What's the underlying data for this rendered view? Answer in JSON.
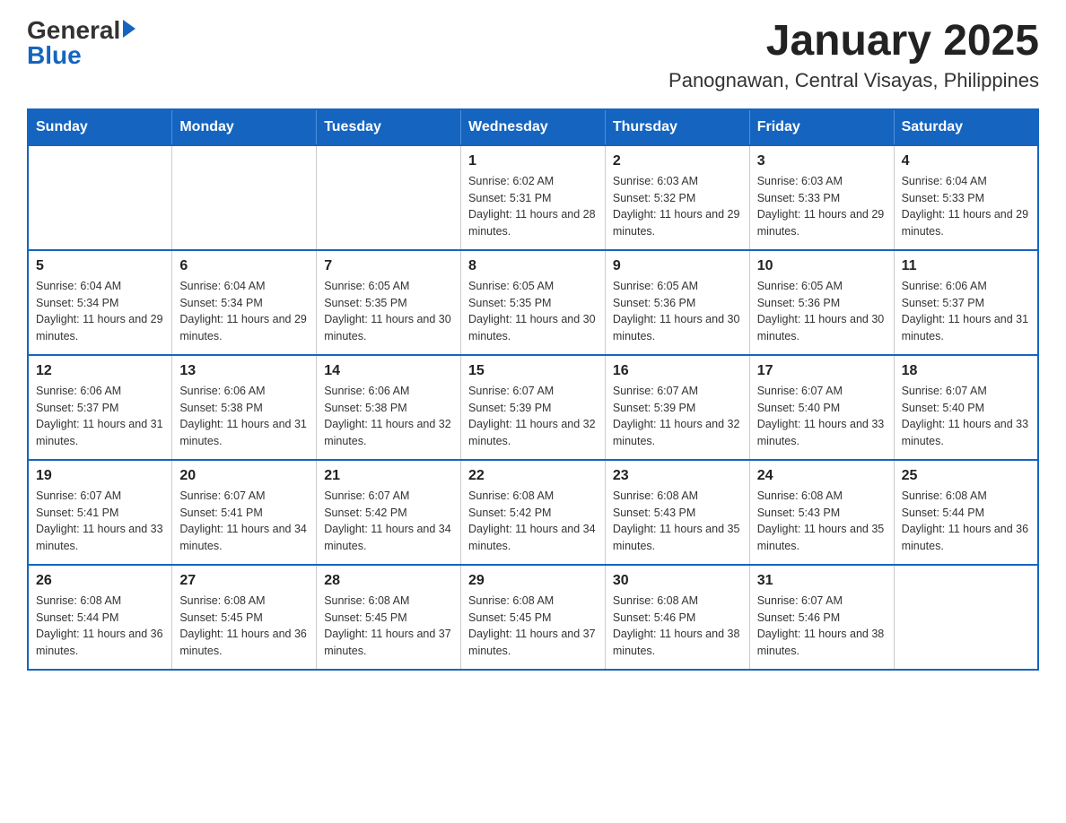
{
  "logo": {
    "general": "General",
    "blue": "Blue"
  },
  "title": "January 2025",
  "subtitle": "Panognawan, Central Visayas, Philippines",
  "days_header": [
    "Sunday",
    "Monday",
    "Tuesday",
    "Wednesday",
    "Thursday",
    "Friday",
    "Saturday"
  ],
  "weeks": [
    [
      {
        "day": "",
        "info": ""
      },
      {
        "day": "",
        "info": ""
      },
      {
        "day": "",
        "info": ""
      },
      {
        "day": "1",
        "info": "Sunrise: 6:02 AM\nSunset: 5:31 PM\nDaylight: 11 hours and 28 minutes."
      },
      {
        "day": "2",
        "info": "Sunrise: 6:03 AM\nSunset: 5:32 PM\nDaylight: 11 hours and 29 minutes."
      },
      {
        "day": "3",
        "info": "Sunrise: 6:03 AM\nSunset: 5:33 PM\nDaylight: 11 hours and 29 minutes."
      },
      {
        "day": "4",
        "info": "Sunrise: 6:04 AM\nSunset: 5:33 PM\nDaylight: 11 hours and 29 minutes."
      }
    ],
    [
      {
        "day": "5",
        "info": "Sunrise: 6:04 AM\nSunset: 5:34 PM\nDaylight: 11 hours and 29 minutes."
      },
      {
        "day": "6",
        "info": "Sunrise: 6:04 AM\nSunset: 5:34 PM\nDaylight: 11 hours and 29 minutes."
      },
      {
        "day": "7",
        "info": "Sunrise: 6:05 AM\nSunset: 5:35 PM\nDaylight: 11 hours and 30 minutes."
      },
      {
        "day": "8",
        "info": "Sunrise: 6:05 AM\nSunset: 5:35 PM\nDaylight: 11 hours and 30 minutes."
      },
      {
        "day": "9",
        "info": "Sunrise: 6:05 AM\nSunset: 5:36 PM\nDaylight: 11 hours and 30 minutes."
      },
      {
        "day": "10",
        "info": "Sunrise: 6:05 AM\nSunset: 5:36 PM\nDaylight: 11 hours and 30 minutes."
      },
      {
        "day": "11",
        "info": "Sunrise: 6:06 AM\nSunset: 5:37 PM\nDaylight: 11 hours and 31 minutes."
      }
    ],
    [
      {
        "day": "12",
        "info": "Sunrise: 6:06 AM\nSunset: 5:37 PM\nDaylight: 11 hours and 31 minutes."
      },
      {
        "day": "13",
        "info": "Sunrise: 6:06 AM\nSunset: 5:38 PM\nDaylight: 11 hours and 31 minutes."
      },
      {
        "day": "14",
        "info": "Sunrise: 6:06 AM\nSunset: 5:38 PM\nDaylight: 11 hours and 32 minutes."
      },
      {
        "day": "15",
        "info": "Sunrise: 6:07 AM\nSunset: 5:39 PM\nDaylight: 11 hours and 32 minutes."
      },
      {
        "day": "16",
        "info": "Sunrise: 6:07 AM\nSunset: 5:39 PM\nDaylight: 11 hours and 32 minutes."
      },
      {
        "day": "17",
        "info": "Sunrise: 6:07 AM\nSunset: 5:40 PM\nDaylight: 11 hours and 33 minutes."
      },
      {
        "day": "18",
        "info": "Sunrise: 6:07 AM\nSunset: 5:40 PM\nDaylight: 11 hours and 33 minutes."
      }
    ],
    [
      {
        "day": "19",
        "info": "Sunrise: 6:07 AM\nSunset: 5:41 PM\nDaylight: 11 hours and 33 minutes."
      },
      {
        "day": "20",
        "info": "Sunrise: 6:07 AM\nSunset: 5:41 PM\nDaylight: 11 hours and 34 minutes."
      },
      {
        "day": "21",
        "info": "Sunrise: 6:07 AM\nSunset: 5:42 PM\nDaylight: 11 hours and 34 minutes."
      },
      {
        "day": "22",
        "info": "Sunrise: 6:08 AM\nSunset: 5:42 PM\nDaylight: 11 hours and 34 minutes."
      },
      {
        "day": "23",
        "info": "Sunrise: 6:08 AM\nSunset: 5:43 PM\nDaylight: 11 hours and 35 minutes."
      },
      {
        "day": "24",
        "info": "Sunrise: 6:08 AM\nSunset: 5:43 PM\nDaylight: 11 hours and 35 minutes."
      },
      {
        "day": "25",
        "info": "Sunrise: 6:08 AM\nSunset: 5:44 PM\nDaylight: 11 hours and 36 minutes."
      }
    ],
    [
      {
        "day": "26",
        "info": "Sunrise: 6:08 AM\nSunset: 5:44 PM\nDaylight: 11 hours and 36 minutes."
      },
      {
        "day": "27",
        "info": "Sunrise: 6:08 AM\nSunset: 5:45 PM\nDaylight: 11 hours and 36 minutes."
      },
      {
        "day": "28",
        "info": "Sunrise: 6:08 AM\nSunset: 5:45 PM\nDaylight: 11 hours and 37 minutes."
      },
      {
        "day": "29",
        "info": "Sunrise: 6:08 AM\nSunset: 5:45 PM\nDaylight: 11 hours and 37 minutes."
      },
      {
        "day": "30",
        "info": "Sunrise: 6:08 AM\nSunset: 5:46 PM\nDaylight: 11 hours and 38 minutes."
      },
      {
        "day": "31",
        "info": "Sunrise: 6:07 AM\nSunset: 5:46 PM\nDaylight: 11 hours and 38 minutes."
      },
      {
        "day": "",
        "info": ""
      }
    ]
  ]
}
